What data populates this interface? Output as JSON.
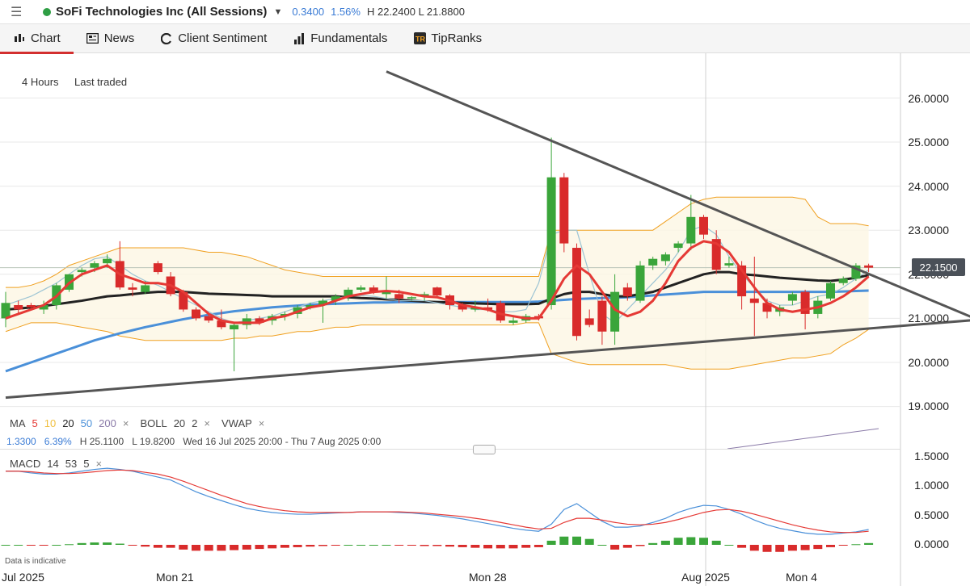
{
  "topbar": {
    "instrument": "SoFi Technologies Inc (All Sessions)",
    "change": "0.3400",
    "change_pct": "1.56%",
    "high_low": "H 22.2400  L 21.8800",
    "status_color": "#2e9e44"
  },
  "tabs": [
    {
      "label": "Chart",
      "icon": "candle-chart-icon",
      "active": true
    },
    {
      "label": "News",
      "icon": "newspaper-icon"
    },
    {
      "label": "Client Sentiment",
      "icon": "sentiment-gauge-icon"
    },
    {
      "label": "Fundamentals",
      "icon": "bar-chart-icon"
    },
    {
      "label": "TipRanks",
      "icon": "tipranks-logo-icon"
    }
  ],
  "chart_controls": {
    "timeframe": "4 Hours",
    "price_type": "Last traded"
  },
  "current_price": "22.1500",
  "y_axis_labels": [
    "26.0000",
    "25.0000",
    "24.0000",
    "23.0000",
    "22.0000",
    "21.0000",
    "20.0000",
    "19.0000"
  ],
  "macd_axis_labels": [
    "1.5000",
    "1.0000",
    "0.5000",
    "0.0000"
  ],
  "x_axis_labels": [
    "Jul 2025",
    "Mon 21",
    "Mon 28",
    "Aug 2025",
    "Mon 4"
  ],
  "legend": {
    "ma": "MA",
    "ma5": "5",
    "ma10": "10",
    "ma20": "20",
    "ma50": "50",
    "ma200": "200",
    "boll": "BOLL",
    "boll_period": "20",
    "boll_dev": "2",
    "vwap": "VWAP",
    "close": "×"
  },
  "info_line": {
    "change": "1.3300",
    "change_pct": "6.39%",
    "high": "H 25.1100",
    "low": "L 19.8200",
    "range": "Wed 16 Jul 2025 20:00 - Thu 7 Aug 2025 0:00"
  },
  "macd_legend": {
    "name": "MACD",
    "fast": "14",
    "slow": "53",
    "signal": "5",
    "close": "×"
  },
  "footnote": "Data is indicative",
  "colors": {
    "up": "#3aa53a",
    "down": "#d92b2b",
    "ma5": "#e53935",
    "ma20": "#222222",
    "ma50": "#4a90d9",
    "boll": "#f0a020",
    "accent": "#d32f2f"
  },
  "chart_data": {
    "type": "candlestick",
    "ylim": [
      18.5,
      26.5
    ],
    "candles": [
      {
        "o": 21.0,
        "h": 21.6,
        "l": 20.8,
        "c": 21.35
      },
      {
        "o": 21.3,
        "h": 21.4,
        "l": 21.1,
        "c": 21.2
      },
      {
        "o": 21.3,
        "h": 21.35,
        "l": 21.2,
        "c": 21.25
      },
      {
        "o": 21.2,
        "h": 21.4,
        "l": 21.1,
        "c": 21.3
      },
      {
        "o": 21.3,
        "h": 21.8,
        "l": 21.2,
        "c": 21.75
      },
      {
        "o": 21.65,
        "h": 22.0,
        "l": 21.6,
        "c": 22.0
      },
      {
        "o": 22.05,
        "h": 22.15,
        "l": 21.95,
        "c": 22.1
      },
      {
        "o": 22.15,
        "h": 22.3,
        "l": 22.05,
        "c": 22.25
      },
      {
        "o": 22.25,
        "h": 22.45,
        "l": 22.15,
        "c": 22.35
      },
      {
        "o": 22.3,
        "h": 22.75,
        "l": 21.65,
        "c": 21.7
      },
      {
        "o": 21.7,
        "h": 21.8,
        "l": 21.5,
        "c": 21.65
      },
      {
        "o": 21.6,
        "h": 21.85,
        "l": 21.55,
        "c": 21.75
      },
      {
        "o": 22.25,
        "h": 22.3,
        "l": 22.0,
        "c": 22.05
      },
      {
        "o": 21.95,
        "h": 22.05,
        "l": 21.5,
        "c": 21.55
      },
      {
        "o": 21.6,
        "h": 21.65,
        "l": 21.15,
        "c": 21.2
      },
      {
        "o": 21.2,
        "h": 21.25,
        "l": 20.95,
        "c": 21.0
      },
      {
        "o": 21.05,
        "h": 21.1,
        "l": 20.9,
        "c": 20.95
      },
      {
        "o": 20.95,
        "h": 21.2,
        "l": 20.75,
        "c": 20.8
      },
      {
        "o": 20.75,
        "h": 20.9,
        "l": 19.8,
        "c": 20.85
      },
      {
        "o": 20.85,
        "h": 21.1,
        "l": 20.75,
        "c": 21.0
      },
      {
        "o": 21.0,
        "h": 21.05,
        "l": 20.85,
        "c": 20.9
      },
      {
        "o": 20.95,
        "h": 21.1,
        "l": 20.85,
        "c": 21.05
      },
      {
        "o": 21.05,
        "h": 21.15,
        "l": 20.95,
        "c": 21.1
      },
      {
        "o": 21.1,
        "h": 21.3,
        "l": 21.0,
        "c": 21.25
      },
      {
        "o": 21.25,
        "h": 21.35,
        "l": 21.2,
        "c": 21.3
      },
      {
        "o": 21.3,
        "h": 21.45,
        "l": 20.9,
        "c": 21.4
      },
      {
        "o": 21.4,
        "h": 21.55,
        "l": 21.3,
        "c": 21.5
      },
      {
        "o": 21.5,
        "h": 21.7,
        "l": 21.4,
        "c": 21.65
      },
      {
        "o": 21.65,
        "h": 21.75,
        "l": 21.6,
        "c": 21.7
      },
      {
        "o": 21.7,
        "h": 21.75,
        "l": 21.55,
        "c": 21.6
      },
      {
        "o": 21.55,
        "h": 21.95,
        "l": 21.45,
        "c": 21.6
      },
      {
        "o": 21.55,
        "h": 21.65,
        "l": 21.35,
        "c": 21.45
      },
      {
        "o": 21.45,
        "h": 21.5,
        "l": 21.4,
        "c": 21.48
      },
      {
        "o": 21.5,
        "h": 21.6,
        "l": 21.4,
        "c": 21.55
      },
      {
        "o": 21.7,
        "h": 21.72,
        "l": 21.5,
        "c": 21.52
      },
      {
        "o": 21.52,
        "h": 21.55,
        "l": 21.2,
        "c": 21.3
      },
      {
        "o": 21.3,
        "h": 21.35,
        "l": 21.15,
        "c": 21.2
      },
      {
        "o": 21.2,
        "h": 21.4,
        "l": 21.15,
        "c": 21.25
      },
      {
        "o": 21.25,
        "h": 21.45,
        "l": 21.15,
        "c": 21.2
      },
      {
        "o": 21.35,
        "h": 21.4,
        "l": 20.9,
        "c": 20.95
      },
      {
        "o": 20.9,
        "h": 21.05,
        "l": 20.85,
        "c": 20.95
      },
      {
        "o": 20.95,
        "h": 21.1,
        "l": 20.9,
        "c": 21.05
      },
      {
        "o": 21.05,
        "h": 21.1,
        "l": 20.95,
        "c": 21.0
      },
      {
        "o": 21.3,
        "h": 25.1,
        "l": 21.2,
        "c": 24.2
      },
      {
        "o": 24.2,
        "h": 24.3,
        "l": 22.5,
        "c": 22.7
      },
      {
        "o": 22.6,
        "h": 22.7,
        "l": 20.5,
        "c": 20.6
      },
      {
        "o": 21.0,
        "h": 21.2,
        "l": 20.8,
        "c": 20.85
      },
      {
        "o": 21.4,
        "h": 21.5,
        "l": 20.4,
        "c": 20.7
      },
      {
        "o": 20.7,
        "h": 22.0,
        "l": 20.4,
        "c": 21.6
      },
      {
        "o": 21.7,
        "h": 21.8,
        "l": 21.4,
        "c": 21.5
      },
      {
        "o": 21.4,
        "h": 22.3,
        "l": 21.35,
        "c": 22.2
      },
      {
        "o": 22.2,
        "h": 22.4,
        "l": 22.1,
        "c": 22.35
      },
      {
        "o": 22.3,
        "h": 22.5,
        "l": 22.2,
        "c": 22.45
      },
      {
        "o": 22.6,
        "h": 22.75,
        "l": 22.5,
        "c": 22.7
      },
      {
        "o": 22.7,
        "h": 23.8,
        "l": 22.55,
        "c": 23.3
      },
      {
        "o": 23.3,
        "h": 23.35,
        "l": 22.8,
        "c": 22.9
      },
      {
        "o": 22.8,
        "h": 23.0,
        "l": 22.0,
        "c": 22.1
      },
      {
        "o": 22.2,
        "h": 22.4,
        "l": 22.15,
        "c": 22.25
      },
      {
        "o": 22.2,
        "h": 22.3,
        "l": 21.2,
        "c": 21.5
      },
      {
        "o": 21.45,
        "h": 22.4,
        "l": 20.6,
        "c": 21.35
      },
      {
        "o": 21.35,
        "h": 21.45,
        "l": 21.0,
        "c": 21.15
      },
      {
        "o": 21.15,
        "h": 21.3,
        "l": 21.05,
        "c": 21.25
      },
      {
        "o": 21.4,
        "h": 21.6,
        "l": 21.3,
        "c": 21.55
      },
      {
        "o": 21.6,
        "h": 21.65,
        "l": 20.75,
        "c": 21.1
      },
      {
        "o": 21.1,
        "h": 21.5,
        "l": 21.0,
        "c": 21.4
      },
      {
        "o": 21.45,
        "h": 21.85,
        "l": 21.4,
        "c": 21.8
      },
      {
        "o": 21.8,
        "h": 21.95,
        "l": 21.75,
        "c": 21.9
      },
      {
        "o": 21.9,
        "h": 22.25,
        "l": 21.85,
        "c": 22.2
      },
      {
        "o": 22.2,
        "h": 22.24,
        "l": 22.05,
        "c": 22.15
      }
    ],
    "ma5": [
      21.0,
      21.1,
      21.2,
      21.3,
      21.5,
      21.8,
      22.0,
      22.1,
      22.2,
      22.0,
      21.9,
      21.8,
      21.8,
      21.75,
      21.6,
      21.35,
      21.1,
      20.95,
      20.9,
      20.9,
      20.9,
      21.0,
      21.05,
      21.15,
      21.25,
      21.3,
      21.4,
      21.5,
      21.55,
      21.6,
      21.62,
      21.6,
      21.55,
      21.5,
      21.48,
      21.4,
      21.3,
      21.25,
      21.2,
      21.1,
      21.05,
      21.0,
      21.0,
      21.4,
      21.9,
      22.2,
      22.0,
      21.6,
      21.2,
      21.05,
      21.15,
      21.4,
      21.8,
      22.3,
      22.6,
      22.75,
      22.7,
      22.5,
      22.1,
      21.7,
      21.35,
      21.2,
      21.15,
      21.2,
      21.25,
      21.35,
      21.5,
      21.7,
      21.95
    ],
    "ma20": [
      21.2,
      21.22,
      21.25,
      21.28,
      21.32,
      21.36,
      21.4,
      21.45,
      21.5,
      21.52,
      21.55,
      21.58,
      21.6,
      21.6,
      21.6,
      21.58,
      21.56,
      21.55,
      21.54,
      21.53,
      21.52,
      21.5,
      21.5,
      21.5,
      21.5,
      21.5,
      21.5,
      21.48,
      21.46,
      21.45,
      21.43,
      21.42,
      21.4,
      21.38,
      21.37,
      21.36,
      21.35,
      21.34,
      21.33,
      21.32,
      21.32,
      21.32,
      21.33,
      21.45,
      21.55,
      21.6,
      21.6,
      21.55,
      21.5,
      21.5,
      21.55,
      21.6,
      21.7,
      21.8,
      21.9,
      22.0,
      22.05,
      22.05,
      22.0,
      21.98,
      21.95,
      21.92,
      21.9,
      21.88,
      21.86,
      21.85,
      21.88,
      21.92,
      21.98
    ],
    "ma50": [
      19.8,
      19.9,
      20.0,
      20.1,
      20.2,
      20.3,
      20.4,
      20.5,
      20.58,
      20.66,
      20.73,
      20.8,
      20.86,
      20.92,
      20.98,
      21.03,
      21.08,
      21.12,
      21.16,
      21.19,
      21.22,
      21.25,
      21.27,
      21.29,
      21.31,
      21.32,
      21.33,
      21.34,
      21.35,
      21.36,
      21.36,
      21.37,
      21.37,
      21.37,
      21.37,
      21.37,
      21.37,
      21.37,
      21.37,
      21.37,
      21.37,
      21.37,
      21.38,
      21.4,
      21.42,
      21.44,
      21.45,
      21.46,
      21.47,
      21.48,
      21.5,
      21.52,
      21.54,
      21.56,
      21.58,
      21.6,
      21.6,
      21.6,
      21.6,
      21.6,
      21.6,
      21.6,
      21.6,
      21.6,
      21.6,
      21.6,
      21.61,
      21.62,
      21.63
    ],
    "boll_upper": [
      21.7,
      21.7,
      21.75,
      21.85,
      22.0,
      22.2,
      22.3,
      22.4,
      22.5,
      22.6,
      22.6,
      22.6,
      22.6,
      22.6,
      22.6,
      22.55,
      22.5,
      22.5,
      22.45,
      22.4,
      22.3,
      22.2,
      22.1,
      22.05,
      22.0,
      21.95,
      21.95,
      21.95,
      21.95,
      21.95,
      21.95,
      21.95,
      21.95,
      21.95,
      21.95,
      21.95,
      21.95,
      21.95,
      21.95,
      21.95,
      21.95,
      21.95,
      21.95,
      23.0,
      23.0,
      23.0,
      23.0,
      23.0,
      23.0,
      23.0,
      23.0,
      23.0,
      23.2,
      23.4,
      23.6,
      23.7,
      23.75,
      23.75,
      23.75,
      23.75,
      23.75,
      23.75,
      23.75,
      23.7,
      23.3,
      23.15,
      23.15,
      23.15,
      23.1
    ],
    "boll_lower": [
      20.7,
      20.8,
      20.9,
      20.9,
      20.9,
      20.85,
      20.8,
      20.75,
      20.7,
      20.6,
      20.55,
      20.5,
      20.5,
      20.5,
      20.5,
      20.5,
      20.5,
      20.5,
      20.55,
      20.55,
      20.6,
      20.6,
      20.65,
      20.7,
      20.7,
      20.75,
      20.8,
      20.8,
      20.85,
      20.85,
      20.85,
      20.85,
      20.85,
      20.85,
      20.85,
      20.85,
      20.85,
      20.85,
      20.85,
      20.85,
      20.85,
      20.9,
      20.9,
      20.2,
      20.1,
      20.0,
      19.95,
      19.95,
      19.95,
      19.95,
      19.95,
      19.95,
      19.95,
      19.9,
      19.85,
      19.85,
      19.85,
      19.85,
      19.9,
      19.95,
      20.0,
      20.05,
      20.1,
      20.1,
      20.15,
      20.2,
      20.4,
      20.55,
      20.75
    ],
    "vwap": [
      21.3,
      21.4,
      21.5,
      21.65,
      21.8,
      22.0,
      22.2,
      22.35,
      22.4,
      22.2,
      22.0,
      21.85,
      21.75,
      21.6,
      21.45,
      21.3,
      21.15,
      21.0,
      20.9,
      20.95,
      21.0,
      21.05,
      21.15,
      21.25,
      21.35,
      21.4,
      21.45,
      21.5,
      21.52,
      21.5,
      21.45,
      21.4,
      21.4,
      21.4,
      21.35,
      21.3,
      21.25,
      21.2,
      21.2,
      21.15,
      21.15,
      21.2,
      21.8,
      22.9,
      23.0,
      23.0,
      22.0,
      21.1,
      20.9,
      21.2,
      21.5,
      21.8,
      22.1,
      22.5,
      23.0,
      23.1,
      22.9,
      22.4,
      22.0,
      21.7,
      21.4,
      21.3,
      21.3,
      21.4,
      21.5,
      21.55,
      21.7,
      21.9,
      22.1
    ],
    "trendline_upper": {
      "x1_index": 30,
      "y1": 26.6,
      "x2_index": 78,
      "y2": 20.8
    },
    "trendline_lower": {
      "x1_index": 0,
      "y1": 19.2,
      "x2_index": 78,
      "y2": 21.0
    },
    "macd": {
      "ylim": [
        -0.25,
        1.6
      ],
      "macd_line": [
        1.25,
        1.25,
        1.22,
        1.2,
        1.2,
        1.22,
        1.25,
        1.28,
        1.3,
        1.28,
        1.25,
        1.2,
        1.15,
        1.1,
        1.0,
        0.9,
        0.82,
        0.75,
        0.68,
        0.62,
        0.58,
        0.55,
        0.53,
        0.52,
        0.52,
        0.53,
        0.54,
        0.55,
        0.56,
        0.56,
        0.56,
        0.55,
        0.54,
        0.52,
        0.5,
        0.47,
        0.44,
        0.4,
        0.36,
        0.32,
        0.28,
        0.25,
        0.23,
        0.35,
        0.6,
        0.7,
        0.55,
        0.4,
        0.3,
        0.3,
        0.32,
        0.38,
        0.45,
        0.55,
        0.62,
        0.67,
        0.66,
        0.6,
        0.52,
        0.42,
        0.34,
        0.28,
        0.24,
        0.2,
        0.18,
        0.18,
        0.2,
        0.22,
        0.26
      ],
      "signal_line": [
        1.25,
        1.25,
        1.24,
        1.22,
        1.21,
        1.21,
        1.22,
        1.24,
        1.26,
        1.27,
        1.26,
        1.23,
        1.2,
        1.15,
        1.08,
        1.0,
        0.92,
        0.84,
        0.77,
        0.7,
        0.65,
        0.61,
        0.58,
        0.56,
        0.55,
        0.55,
        0.55,
        0.55,
        0.56,
        0.56,
        0.56,
        0.56,
        0.55,
        0.54,
        0.52,
        0.5,
        0.48,
        0.45,
        0.42,
        0.38,
        0.34,
        0.3,
        0.27,
        0.28,
        0.38,
        0.45,
        0.45,
        0.42,
        0.38,
        0.35,
        0.34,
        0.35,
        0.38,
        0.43,
        0.49,
        0.55,
        0.59,
        0.6,
        0.57,
        0.52,
        0.46,
        0.4,
        0.34,
        0.29,
        0.25,
        0.22,
        0.21,
        0.21,
        0.23
      ],
      "histogram": [
        0.0,
        0.0,
        -0.01,
        -0.01,
        0.0,
        0.01,
        0.03,
        0.04,
        0.04,
        0.02,
        -0.01,
        -0.03,
        -0.05,
        -0.05,
        -0.08,
        -0.1,
        -0.1,
        -0.1,
        -0.09,
        -0.08,
        -0.07,
        -0.06,
        -0.05,
        -0.04,
        -0.03,
        -0.02,
        -0.01,
        0.0,
        0.0,
        0.0,
        0.0,
        -0.01,
        -0.01,
        -0.02,
        -0.02,
        -0.03,
        -0.04,
        -0.05,
        -0.06,
        -0.06,
        -0.06,
        -0.05,
        -0.04,
        0.07,
        0.14,
        0.14,
        0.1,
        0.0,
        -0.08,
        -0.05,
        -0.02,
        0.03,
        0.07,
        0.12,
        0.13,
        0.12,
        0.07,
        0.0,
        -0.05,
        -0.1,
        -0.12,
        -0.12,
        -0.1,
        -0.09,
        -0.07,
        -0.04,
        -0.01,
        0.01,
        0.03
      ]
    }
  }
}
